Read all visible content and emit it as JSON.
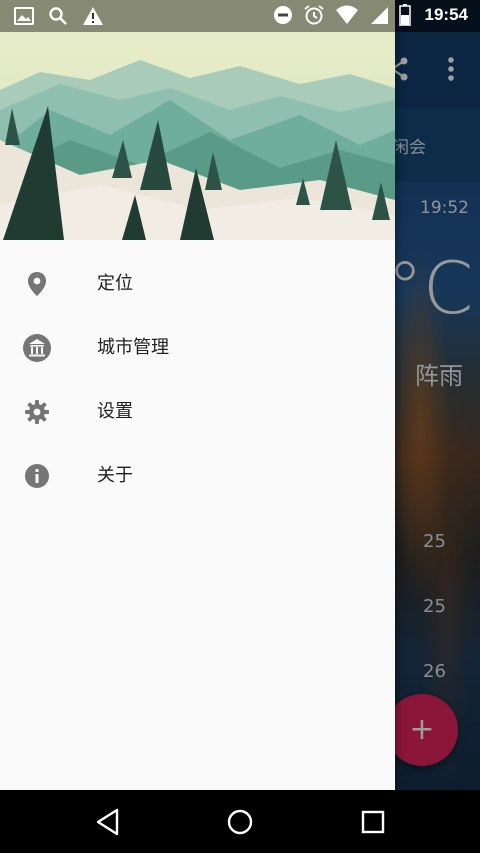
{
  "status_bar": {
    "time": "19:54",
    "icons_left": [
      "image-icon",
      "search-icon",
      "warning-icon"
    ],
    "icons_right": [
      "do-not-disturb-icon",
      "alarm-icon",
      "wifi-icon",
      "signal-icon",
      "battery-icon"
    ]
  },
  "drawer": {
    "menu_items": [
      {
        "label": "定位",
        "icon": "location-pin-icon"
      },
      {
        "label": "城市管理",
        "icon": "landmark-icon"
      },
      {
        "label": "设置",
        "icon": "gear-icon"
      },
      {
        "label": "关于",
        "icon": "info-icon"
      }
    ]
  },
  "background_app": {
    "tab_partial_text": "闲会",
    "update_time": "19:52",
    "temp_unit": "°C",
    "condition": "阵雨",
    "forecast": [
      "25",
      "25",
      "26"
    ],
    "fab_label": "+"
  },
  "nav_bar": {
    "buttons": [
      "back-icon",
      "home-icon",
      "recents-icon"
    ]
  },
  "colors": {
    "drawer_bg": "#fafafa",
    "menu_icon": "#757575",
    "fab": "#e0245e",
    "app_toolbar": "#123d6b"
  }
}
